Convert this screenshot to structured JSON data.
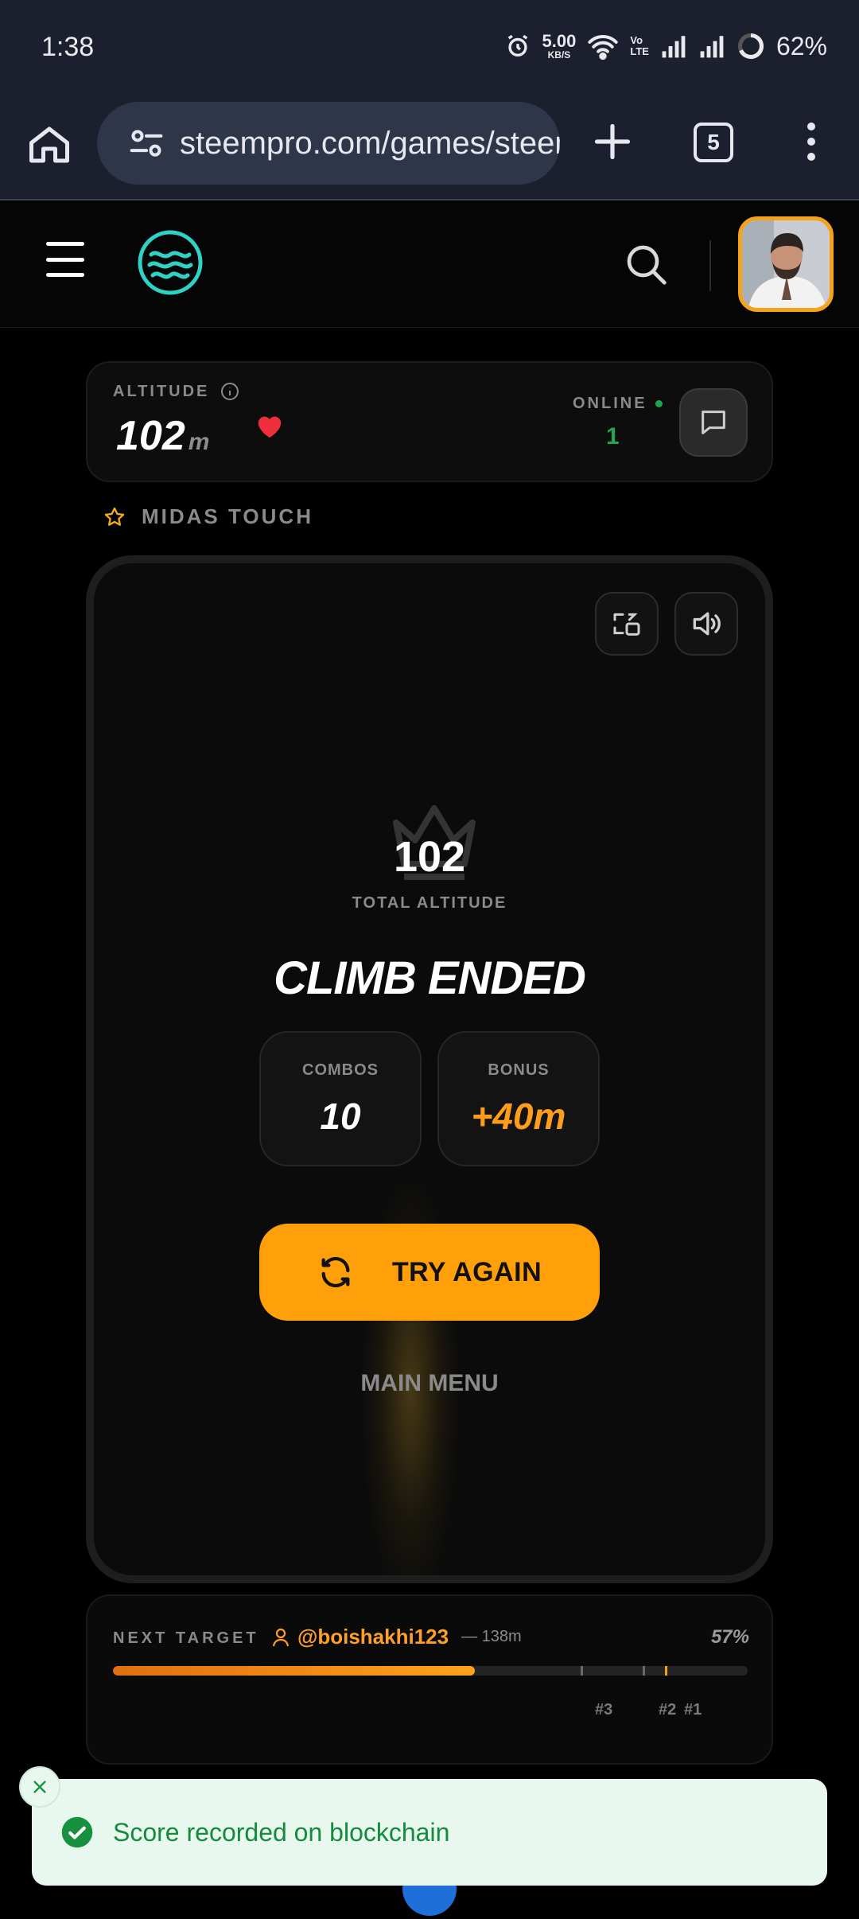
{
  "status_bar": {
    "time": "1:38",
    "net_speed": "5.00",
    "net_unit": "KB/S",
    "volte_top": "Vo",
    "volte_bottom": "LTE",
    "battery": "62%"
  },
  "browser": {
    "url": "steempro.com/games/steem",
    "tab_count": "5"
  },
  "header": {
    "accent_color": "#f7a21b"
  },
  "altitude": {
    "label": "ALTITUDE",
    "value": "102",
    "unit": "m",
    "online_label": "ONLINE",
    "online_count": "1"
  },
  "mode": {
    "label": "MIDAS TOUCH"
  },
  "game": {
    "total_value": "102",
    "total_label": "TOTAL ALTITUDE",
    "title": "CLIMB ENDED",
    "combos_label": "COMBOS",
    "combos_value": "10",
    "bonus_label": "BONUS",
    "bonus_value": "+40m",
    "try_again_label": "TRY AGAIN",
    "main_menu_label": "MAIN MENU"
  },
  "next_target": {
    "label": "NEXT TARGET",
    "username": "@boishakhi123",
    "distance": "— 138m",
    "percent_label": "57%",
    "progress_fraction": 0.57,
    "rank_labels": [
      "#3",
      "#2",
      "#1"
    ]
  },
  "toast": {
    "message": "Score recorded on blockchain",
    "color": "#138a3c"
  }
}
